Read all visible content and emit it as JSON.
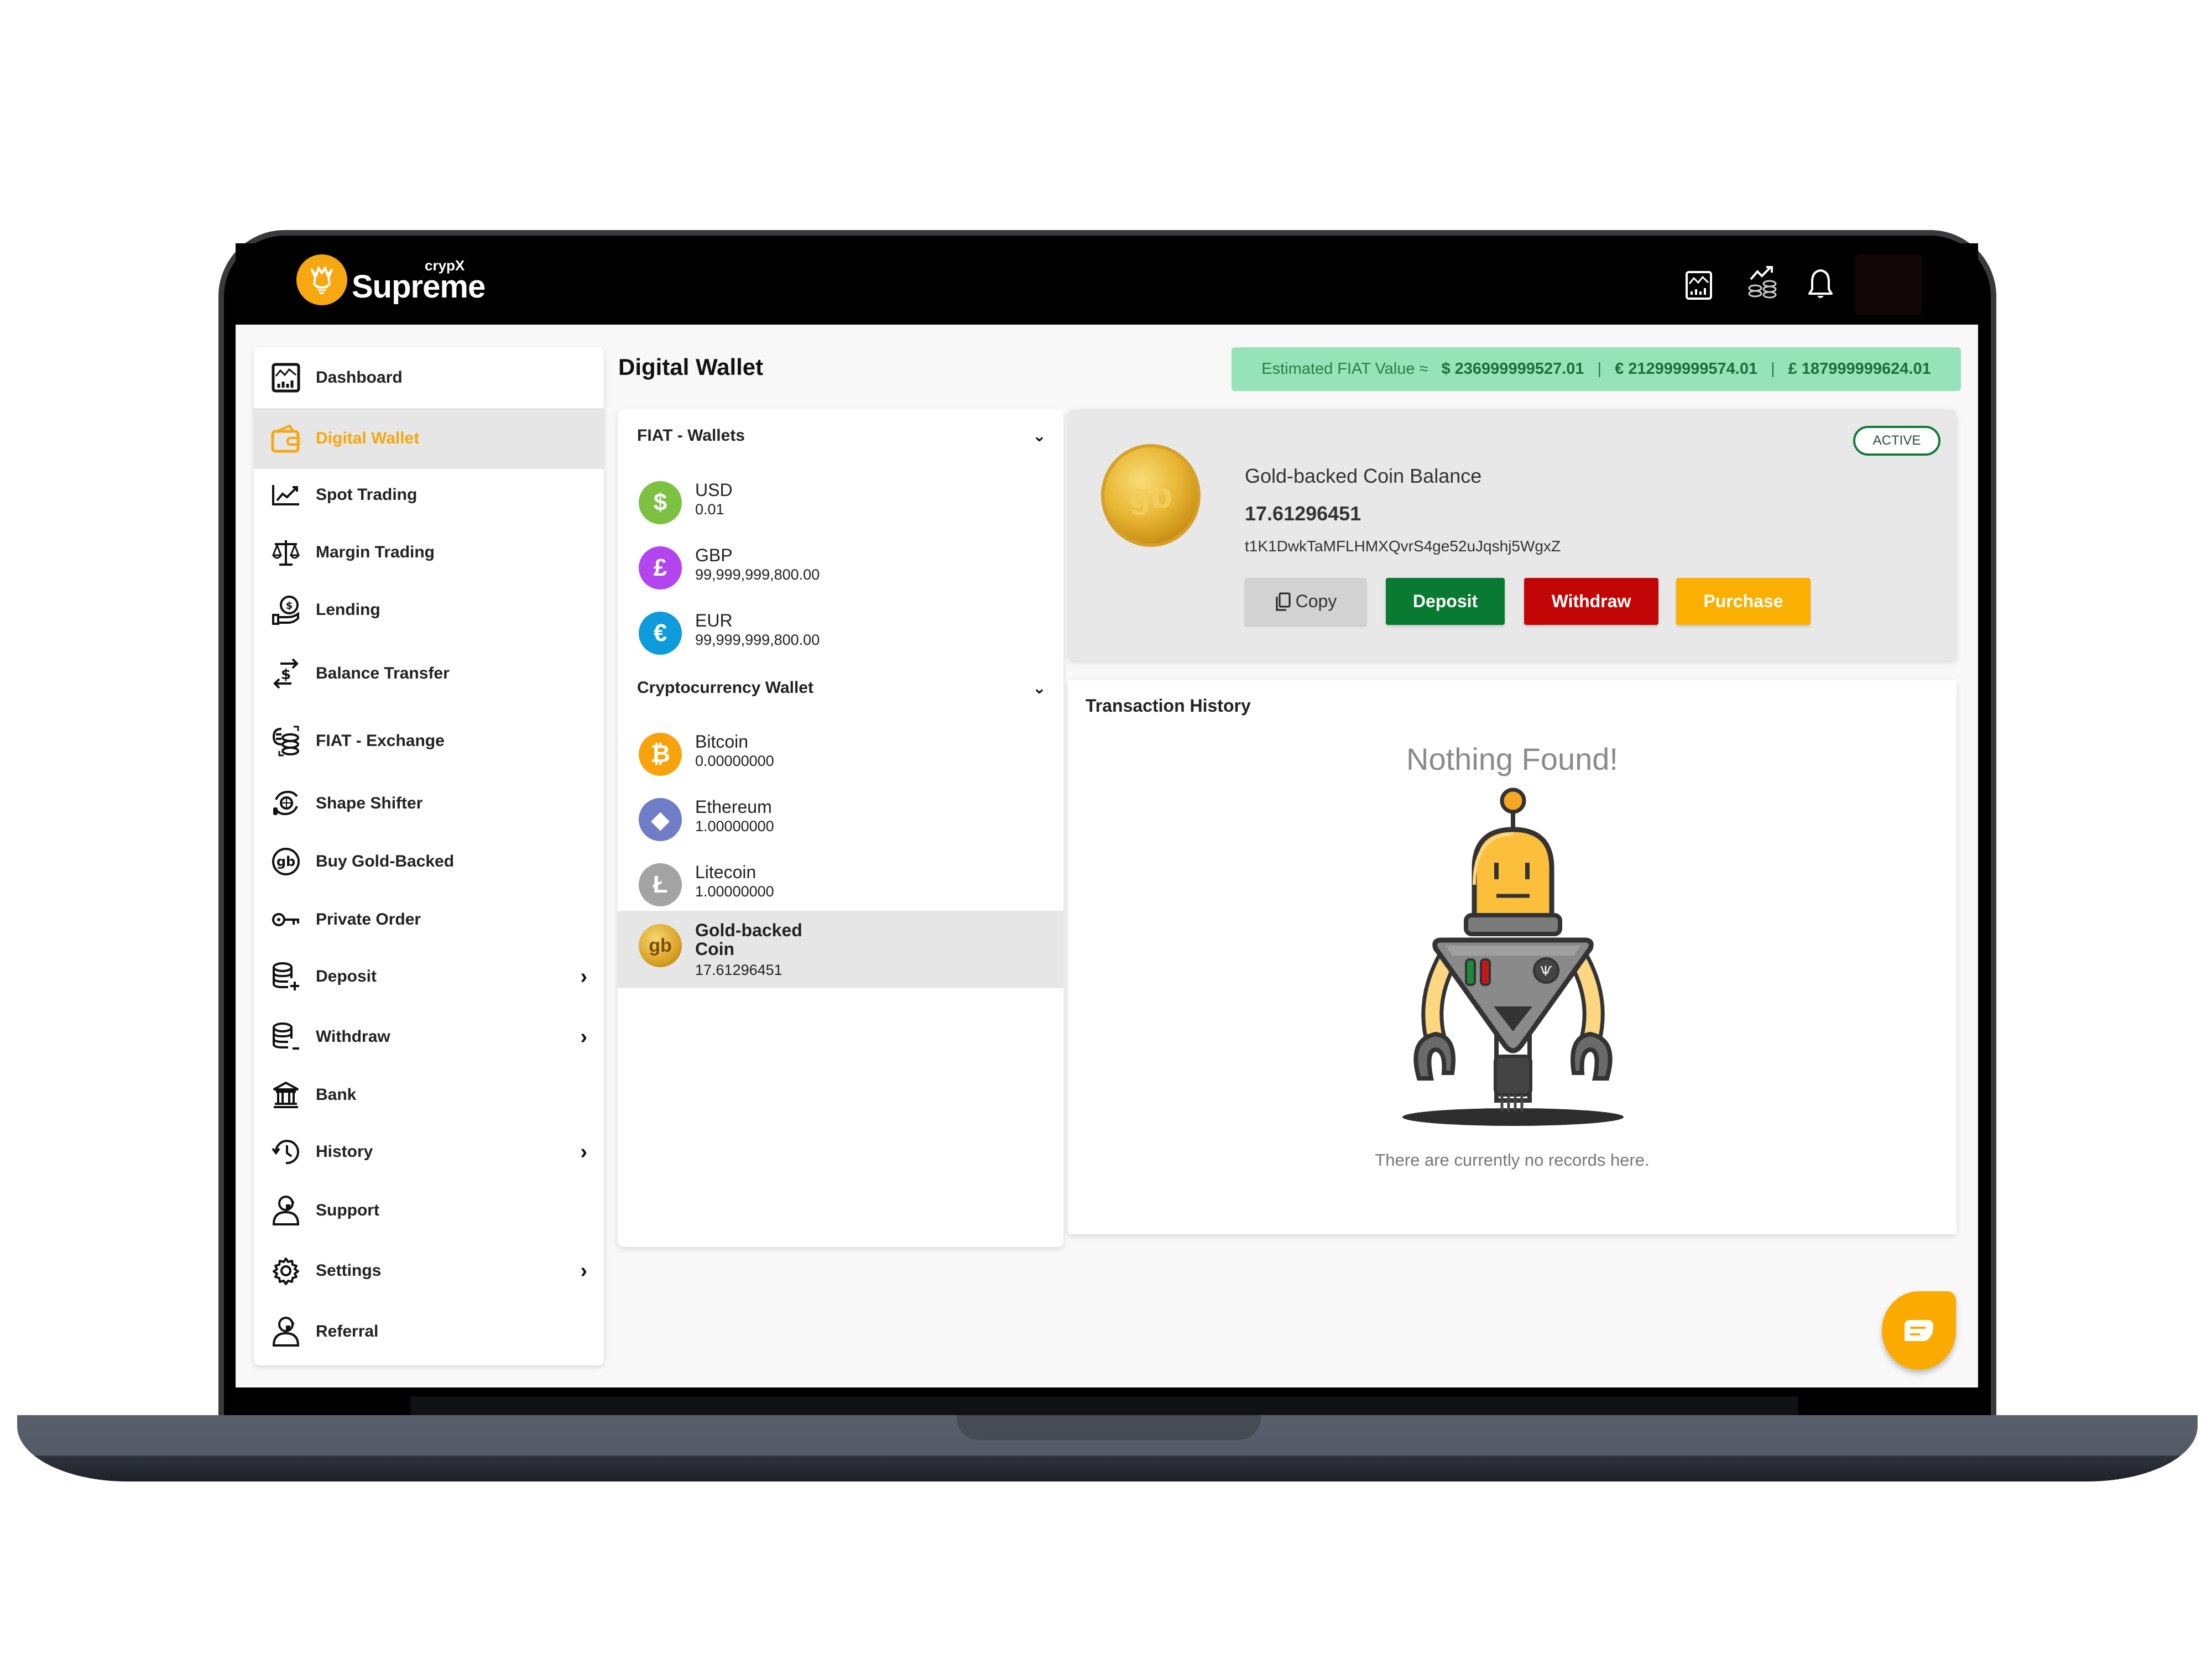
{
  "app": {
    "brand_small": "crypX",
    "brand_big": "Supreme",
    "header_icons": [
      "dashboard-chart-icon",
      "trading-coins-icon",
      "notification-bell-icon"
    ]
  },
  "sidebar": {
    "items": [
      {
        "label": "Dashboard",
        "icon": "dashboard-chart-icon",
        "active": false,
        "has_submenu": false
      },
      {
        "label": "Digital Wallet",
        "icon": "wallet-icon",
        "active": true,
        "has_submenu": false
      },
      {
        "label": "Spot Trading",
        "icon": "line-chart-icon",
        "active": false,
        "has_submenu": false
      },
      {
        "label": "Margin Trading",
        "icon": "scales-icon",
        "active": false,
        "has_submenu": false
      },
      {
        "label": "Lending",
        "icon": "hand-coin-icon",
        "active": false,
        "has_submenu": false
      },
      {
        "label": "Balance Transfer",
        "icon": "dollar-transfer-icon",
        "active": false,
        "has_submenu": false
      },
      {
        "label": "FIAT - Exchange",
        "icon": "currency-exchange-icon",
        "active": false,
        "has_submenu": false
      },
      {
        "label": "Shape Shifter",
        "icon": "globe-exchange-icon",
        "active": false,
        "has_submenu": false
      },
      {
        "label": "Buy Gold-Backed",
        "icon": "gold-coin-icon",
        "active": false,
        "has_submenu": false
      },
      {
        "label": "Private Order",
        "icon": "key-icon",
        "active": false,
        "has_submenu": false
      },
      {
        "label": "Deposit",
        "icon": "coins-plus-icon",
        "active": false,
        "has_submenu": true
      },
      {
        "label": "Withdraw",
        "icon": "coins-minus-icon",
        "active": false,
        "has_submenu": true
      },
      {
        "label": "Bank",
        "icon": "bank-icon",
        "active": false,
        "has_submenu": false
      },
      {
        "label": "History",
        "icon": "history-icon",
        "active": false,
        "has_submenu": true
      },
      {
        "label": "Support",
        "icon": "support-user-icon",
        "active": false,
        "has_submenu": false
      },
      {
        "label": "Settings",
        "icon": "gear-icon",
        "active": false,
        "has_submenu": true
      },
      {
        "label": "Referral",
        "icon": "referral-user-icon",
        "active": false,
        "has_submenu": false
      }
    ]
  },
  "page": {
    "title": "Digital Wallet"
  },
  "fiat_value": {
    "label": "Estimated FIAT Value ≈",
    "usd": "$ 236999999527.01",
    "eur": "€ 212999999574.01",
    "gbp": "£ 187999999624.01",
    "separator": "|",
    "color": "#97e3b9"
  },
  "wallets": {
    "fiat": {
      "title": "FIAT - Wallets",
      "items": [
        {
          "name": "USD",
          "balance": "0.01",
          "symbol": "$",
          "color": "#7cc142"
        },
        {
          "name": "GBP",
          "balance": "99,999,999,800.00",
          "symbol": "£",
          "color": "#b345ee"
        },
        {
          "name": "EUR",
          "balance": "99,999,999,800.00",
          "symbol": "€",
          "color": "#0e9bdc"
        }
      ]
    },
    "crypto": {
      "title": "Cryptocurrency Wallet",
      "items": [
        {
          "name": "Bitcoin",
          "balance": "0.00000000",
          "symbol": "₿",
          "color": "#f8a30c"
        },
        {
          "name": "Ethereum",
          "balance": "1.00000000",
          "symbol": "◆",
          "color": "#6f7cc6"
        },
        {
          "name": "Litecoin",
          "balance": "1.00000000",
          "symbol": "Ł",
          "color": "#a3a3a3"
        },
        {
          "name": "Gold-backed Coin",
          "balance": "17.61296451",
          "symbol": "gb",
          "color": "#d9a426",
          "active": true
        }
      ]
    }
  },
  "balance_card": {
    "status": "ACTIVE",
    "title": "Gold-backed Coin Balance",
    "amount": "17.61296451",
    "address": "t1K1DwkTaMFLHMXQvrS4ge52uJqshj5WgxZ",
    "buttons": {
      "copy": "Copy",
      "deposit": "Deposit",
      "withdraw": "Withdraw",
      "purchase": "Purchase"
    },
    "colors": {
      "deposit": "#087a31",
      "withdraw": "#c20606",
      "purchase": "#fbaf00",
      "active_border": "#137a35"
    }
  },
  "transactions": {
    "title": "Transaction History",
    "empty_title": "Nothing Found!",
    "empty_message": "There are currently no records here."
  },
  "chat": {
    "icon": "chat-bubble-icon"
  },
  "theme": {
    "accent": "#f7a70f"
  }
}
